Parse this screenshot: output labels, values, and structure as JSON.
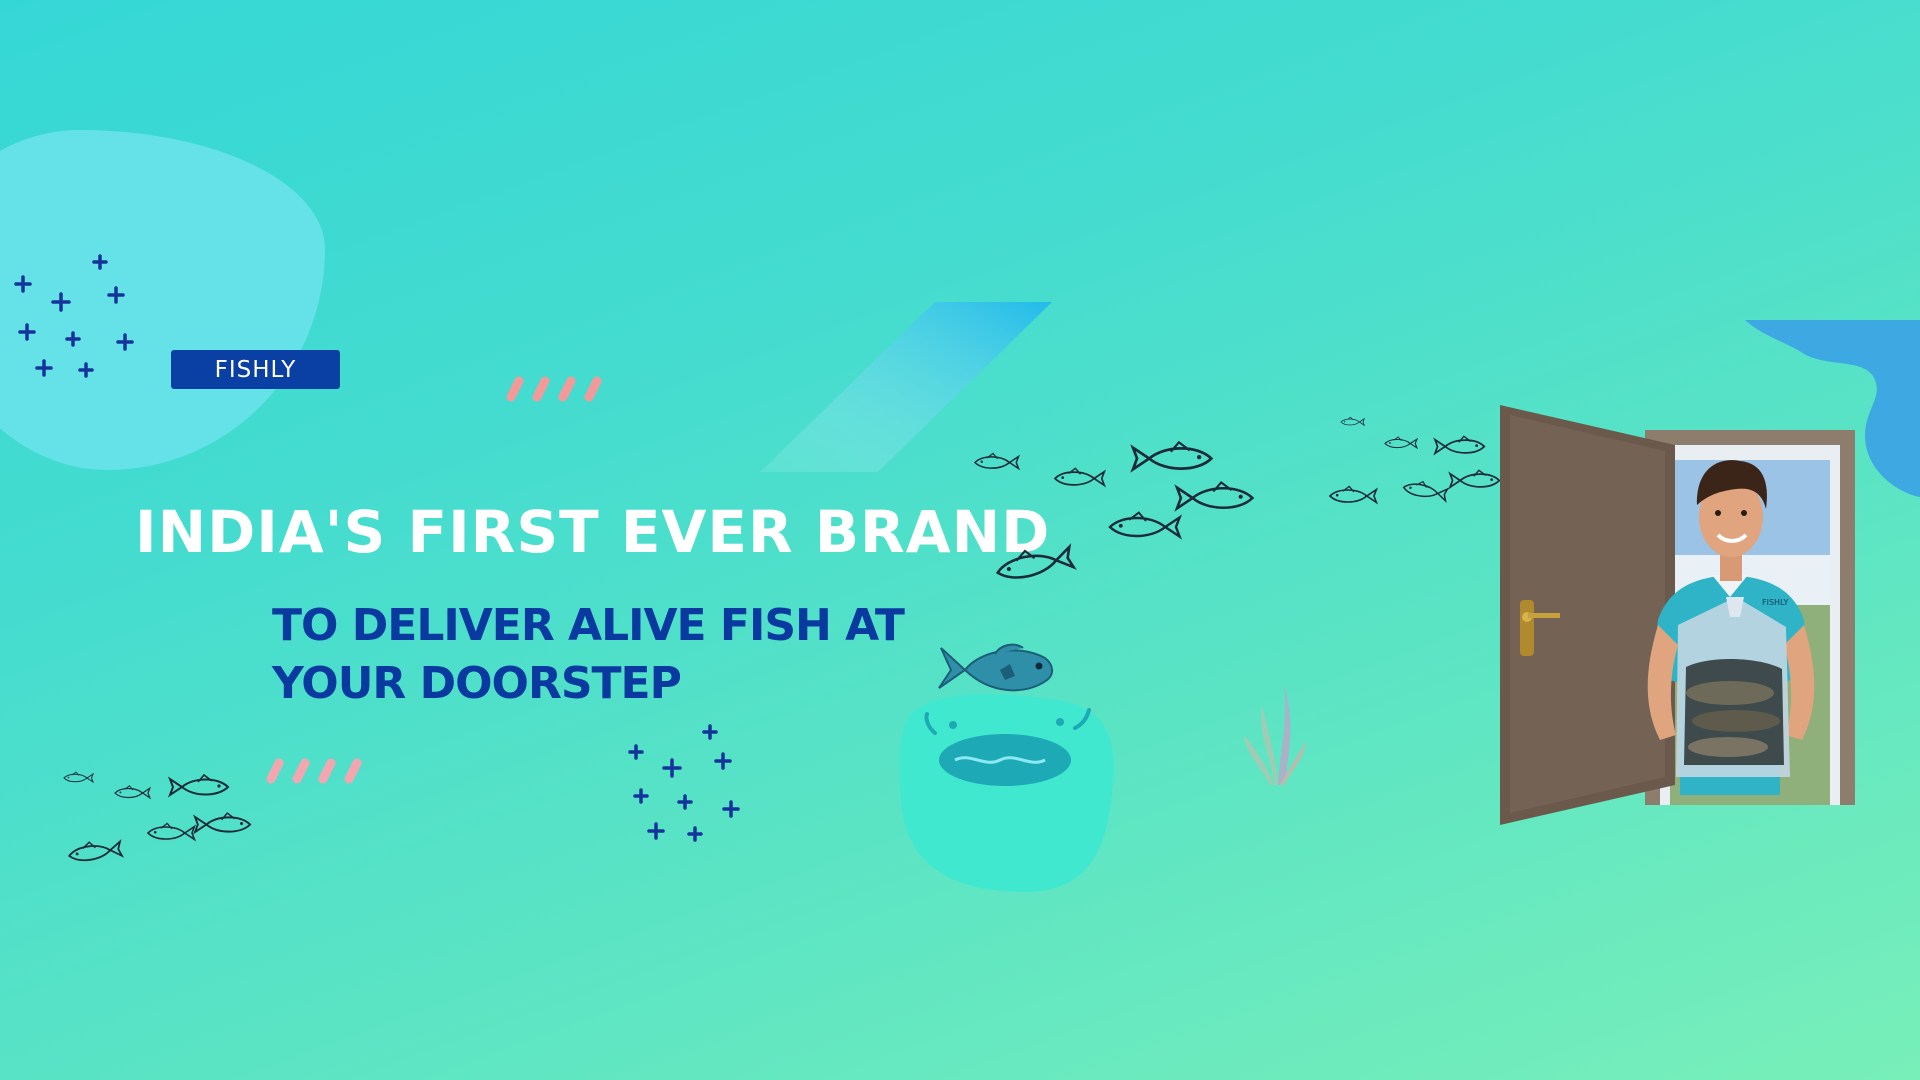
{
  "brand": {
    "name": "FISHLY",
    "shirt_logo_text": "FISHLY"
  },
  "headline": {
    "line1": "INDIA'S FIRST EVER BRAND",
    "line2": "TO DELIVER ALIVE FISH AT",
    "line3": "YOUR DOORSTEP"
  },
  "colors": {
    "background_start": "#35d7d6",
    "background_end": "#78efb9",
    "badge_bg": "#0a3fa3",
    "subheadline": "#0a3aa0",
    "accent_pink": "#f29a9a",
    "plus_marks": "#14349a",
    "door_brown": "#6b5a4c"
  },
  "icons": [
    "plus-pattern",
    "fish-school",
    "jumping-fish",
    "pond",
    "seaweed",
    "open-door",
    "delivery-man"
  ]
}
